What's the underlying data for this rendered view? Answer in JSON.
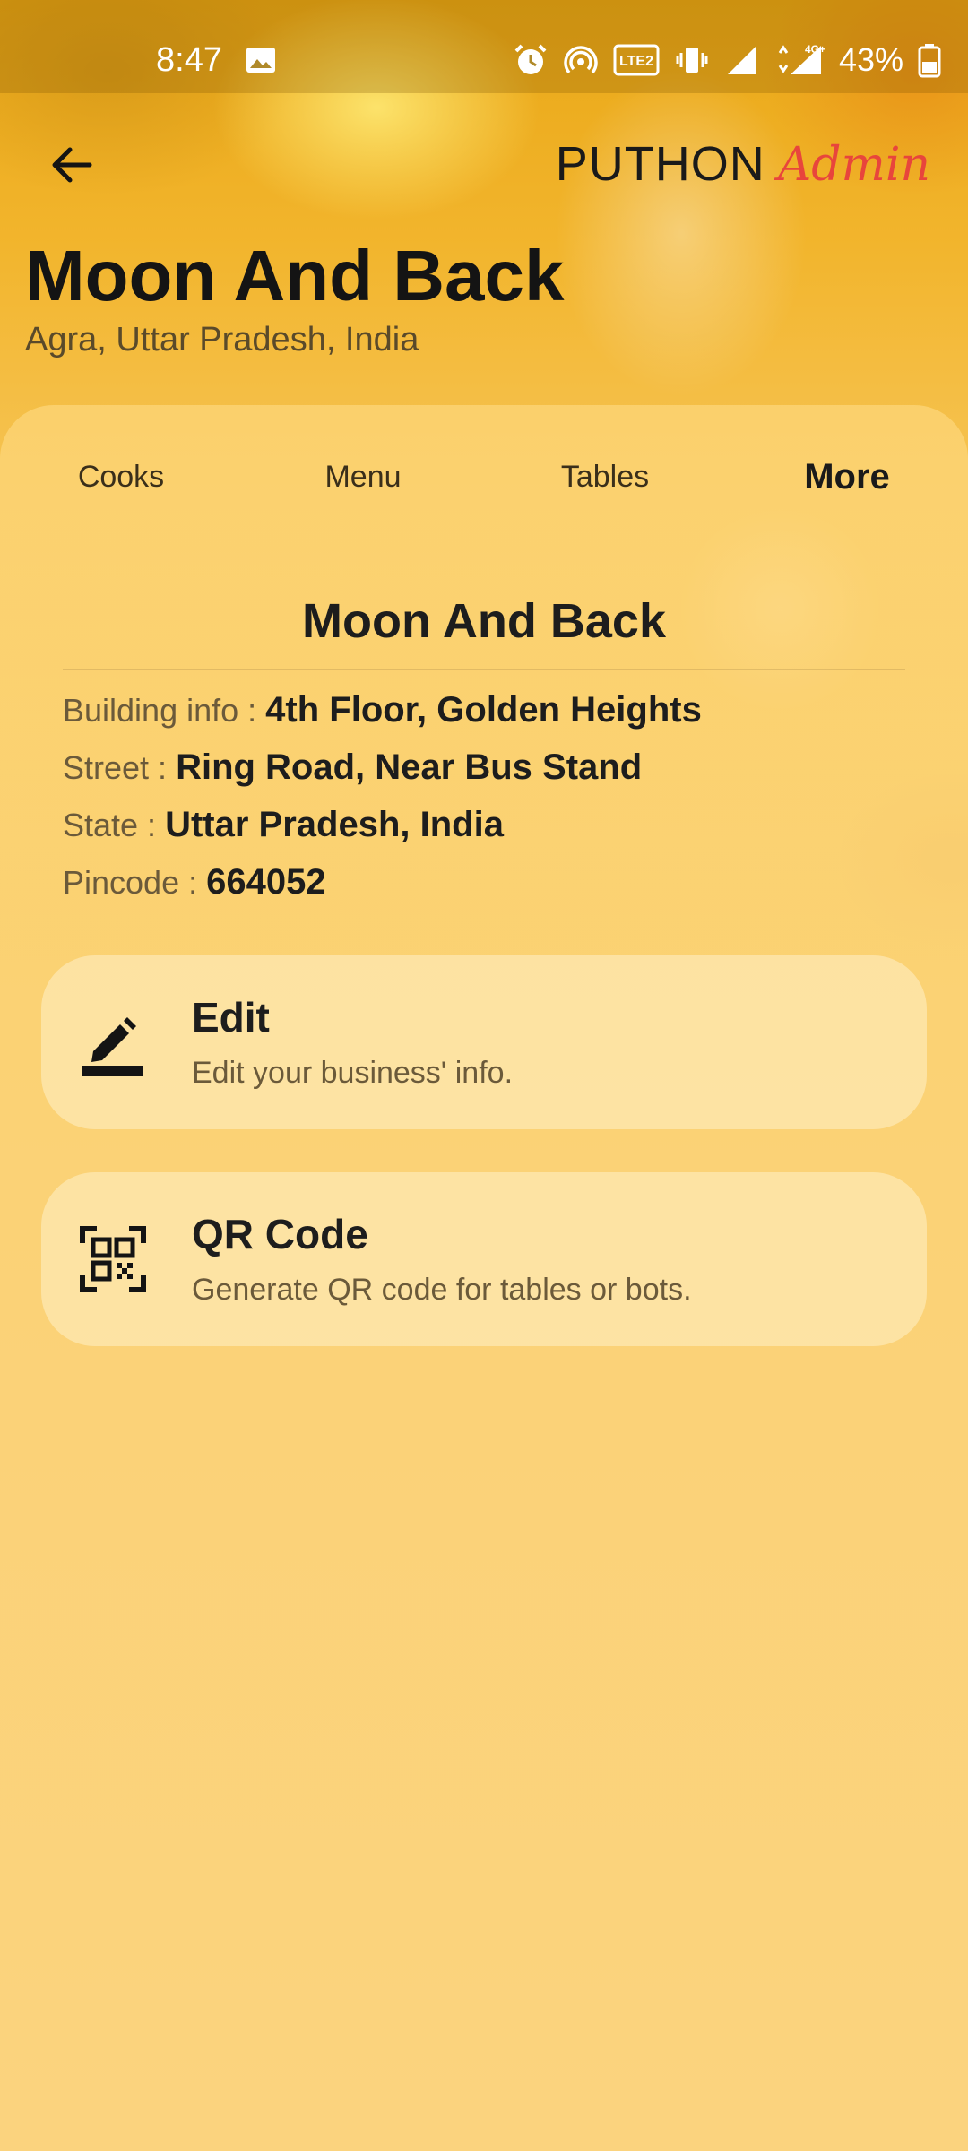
{
  "status_bar": {
    "time": "8:47",
    "battery": "43%",
    "network_label": "4G+"
  },
  "app_bar": {
    "brand_name": "PUTHON",
    "brand_tag": "Admin"
  },
  "business": {
    "name": "Moon And Back",
    "location": "Agra, Uttar Pradesh, India"
  },
  "tabs": [
    {
      "label": "Cooks",
      "active": false
    },
    {
      "label": "Menu",
      "active": false
    },
    {
      "label": "Tables",
      "active": false
    },
    {
      "label": "More",
      "active": true
    }
  ],
  "info": {
    "title": "Moon And Back",
    "rows": [
      {
        "label": "Building info : ",
        "value": "4th Floor, Golden Heights"
      },
      {
        "label": "Street : ",
        "value": "Ring Road, Near Bus Stand"
      },
      {
        "label": "State : ",
        "value": "Uttar Pradesh, India"
      },
      {
        "label": "Pincode : ",
        "value": "664052"
      }
    ]
  },
  "actions": [
    {
      "icon": "edit-icon",
      "title": "Edit",
      "description": "Edit your business' info."
    },
    {
      "icon": "qr-code-icon",
      "title": "QR Code",
      "description": "Generate QR code for tables or bots."
    }
  ],
  "colors": {
    "brand_accent": "#e8453c",
    "background": "#fbd37e"
  }
}
